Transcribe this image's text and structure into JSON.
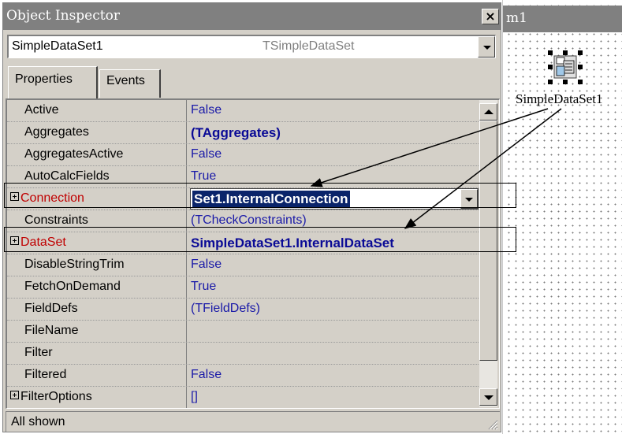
{
  "window": {
    "title": "Object Inspector",
    "close_glyph": "×"
  },
  "component_selector": {
    "name": "SimpleDataSet1",
    "type": "TSimpleDataSet"
  },
  "tabs": [
    {
      "label": "Properties",
      "active": true
    },
    {
      "label": "Events",
      "active": false
    }
  ],
  "properties": [
    {
      "name": "Active",
      "value": "False"
    },
    {
      "name": "Aggregates",
      "value": "(TAggregates)"
    },
    {
      "name": "AggregatesActive",
      "value": "False"
    },
    {
      "name": "AutoCalcFields",
      "value": "True"
    },
    {
      "name": "Connection",
      "value": "Set1.InternalConnection"
    },
    {
      "name": "Constraints",
      "value": "(TCheckConstraints)"
    },
    {
      "name": "DataSet",
      "value": "SimpleDataSet1.InternalDataSet"
    },
    {
      "name": "DisableStringTrim",
      "value": "False"
    },
    {
      "name": "FetchOnDemand",
      "value": "True"
    },
    {
      "name": "FieldDefs",
      "value": "(TFieldDefs)"
    },
    {
      "name": "FileName",
      "value": ""
    },
    {
      "name": "Filter",
      "value": ""
    },
    {
      "name": "Filtered",
      "value": "False"
    },
    {
      "name": "FilterOptions",
      "value": "[]"
    }
  ],
  "status": {
    "text": "All shown"
  },
  "form_designer": {
    "title": "m1",
    "component_label": "SimpleDataSet1",
    "component_icon": "dbx-dataset-icon"
  },
  "colors": {
    "value_text": "#1a1aa8",
    "highlight_property": "#c00000",
    "selection": "#0a246a",
    "titlebar": "#808080",
    "face": "#d4d0c8"
  }
}
